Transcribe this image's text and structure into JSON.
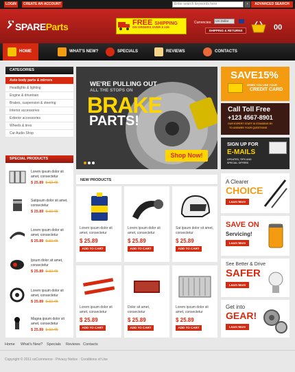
{
  "topbar": {
    "login": "LOGIN",
    "create_account": "CREATE AN ACCOUNT",
    "search_placeholder": "Enter search keywords here",
    "search_go": "›",
    "advanced_search": "ADVANCED SEARCH"
  },
  "header": {
    "logo_spare": "SPARE",
    "logo_parts": "Parts",
    "shipping_big": "FREE",
    "shipping_title": "SHIPPING",
    "shipping_sub": "ON ORDERS OVER $ 139",
    "currencies_label": "Currencies:",
    "currency_value": "US Dollar",
    "shipping_returns": "SHIPPING & RETURNS",
    "cart_count": "00"
  },
  "nav": [
    {
      "label": "HOME",
      "icon": "home-icon"
    },
    {
      "label": "WHAT'S NEW?",
      "icon": "box-icon"
    },
    {
      "label": "SPECIALS",
      "icon": "percent-icon"
    },
    {
      "label": "REVIEWS",
      "icon": "notepad-icon"
    },
    {
      "label": "CONTACTS",
      "icon": "person-icon"
    }
  ],
  "categories": {
    "title": "CATEGORIES",
    "items": [
      "Auto body parts & mirrors",
      "Headlights & lighting",
      "Engine & drivetrain",
      "Brakes, suspension & steering",
      "Interior accessories",
      "Exterior accessories",
      "Wheels & tires",
      "Car Audio Shop"
    ]
  },
  "special_products": {
    "title": "SPECIAL PRODUCTS",
    "items": [
      {
        "text": "Lorem ipsum dolor sit amet, consectetur",
        "price": "$ 25.89",
        "old": "$ 32.45"
      },
      {
        "text": "Satipsum dolor sit amet, consectetur",
        "price": "$ 25.89",
        "old": "$ 32.45"
      },
      {
        "text": "Lorem ipsum dolor sit amet, consectetur",
        "price": "$ 25.89",
        "old": "$ 32.45"
      },
      {
        "text": "Ipsum dolor sit amet, consectetur",
        "price": "$ 25.89",
        "old": "$ 32.45"
      },
      {
        "text": "Lorem ipsum dolor sit amet, consectetur",
        "price": "$ 25.89",
        "old": "$ 32.45"
      },
      {
        "text": "Magna ipsum dolor sit amet, consectetur",
        "price": "$ 25.89",
        "old": "$ 32.45"
      }
    ]
  },
  "banner": {
    "line1": "WE'RE PULLING OUT",
    "line2": "ALL THE STOPS ON",
    "line3": "BRAKE",
    "line4": "PARTS!",
    "button": "Shop Now!"
  },
  "new_products": {
    "title": "NEW PRODUCTS",
    "items": [
      {
        "text": "Lorem ipsum dolor sit amet, consectetur",
        "price": "$ 25.89",
        "button": "ADD TO CART"
      },
      {
        "text": "Lorem ipsum dolor sit amet, consectetur",
        "price": "$ 25.89",
        "button": "ADD TO CART"
      },
      {
        "text": "Sat ipsum dolor sit amet, consectetur",
        "price": "$ 25.89",
        "button": "ADD TO CART"
      },
      {
        "text": "Lorem ipsum dolor sit amet, consectetur",
        "price": "$ 25.89",
        "button": "ADD TO CART"
      },
      {
        "text": "Dolor sit amet, consectetur",
        "price": "$ 25.89",
        "button": "ADD TO CART"
      },
      {
        "text": "Lorem ipsum dolor sit amet, consectetur",
        "price": "$ 25.89",
        "button": "ADD TO CART"
      }
    ]
  },
  "right_banners": {
    "save": {
      "title": "SAVE15%",
      "sub": "WHEN YOU USE YOUR",
      "sub2": "CREDIT CARD"
    },
    "call": {
      "title": "Call Toll Free",
      "phone": "+123 4567-8901",
      "sub": "OUR EXPERT STAFF IS STANDING BY",
      "sub2": "TO ANSWER YOUR QUESTIONS"
    },
    "signup": {
      "title": "SIGN UP FOR",
      "title2": "E-MAILS",
      "sub": "UPDATES, TIPS AND",
      "sub2": "SPECIAL OFFERS"
    },
    "promos": [
      {
        "line1": "A Clearer",
        "line2": "CHOICE",
        "button": "Learn More"
      },
      {
        "line1": "SAVE ON",
        "line2": "Servicing!",
        "button": "Learn More"
      },
      {
        "line1": "See Better & Drive",
        "line2": "SAFER",
        "button": "Learn More"
      },
      {
        "line1": "Get into",
        "line2": "GEAR!",
        "button": "Learn More"
      }
    ]
  },
  "footer": {
    "links": [
      "Home",
      "What's New?",
      "Specials",
      "Reviews",
      "Contacts"
    ],
    "copyright": "Copyright © 2011 osCommerce  ·  Privacy Notice  ·  Conditions of Use"
  },
  "colors": {
    "accent": "#d62a10",
    "highlight": "#ffd500",
    "dark": "#1a1a1a"
  }
}
